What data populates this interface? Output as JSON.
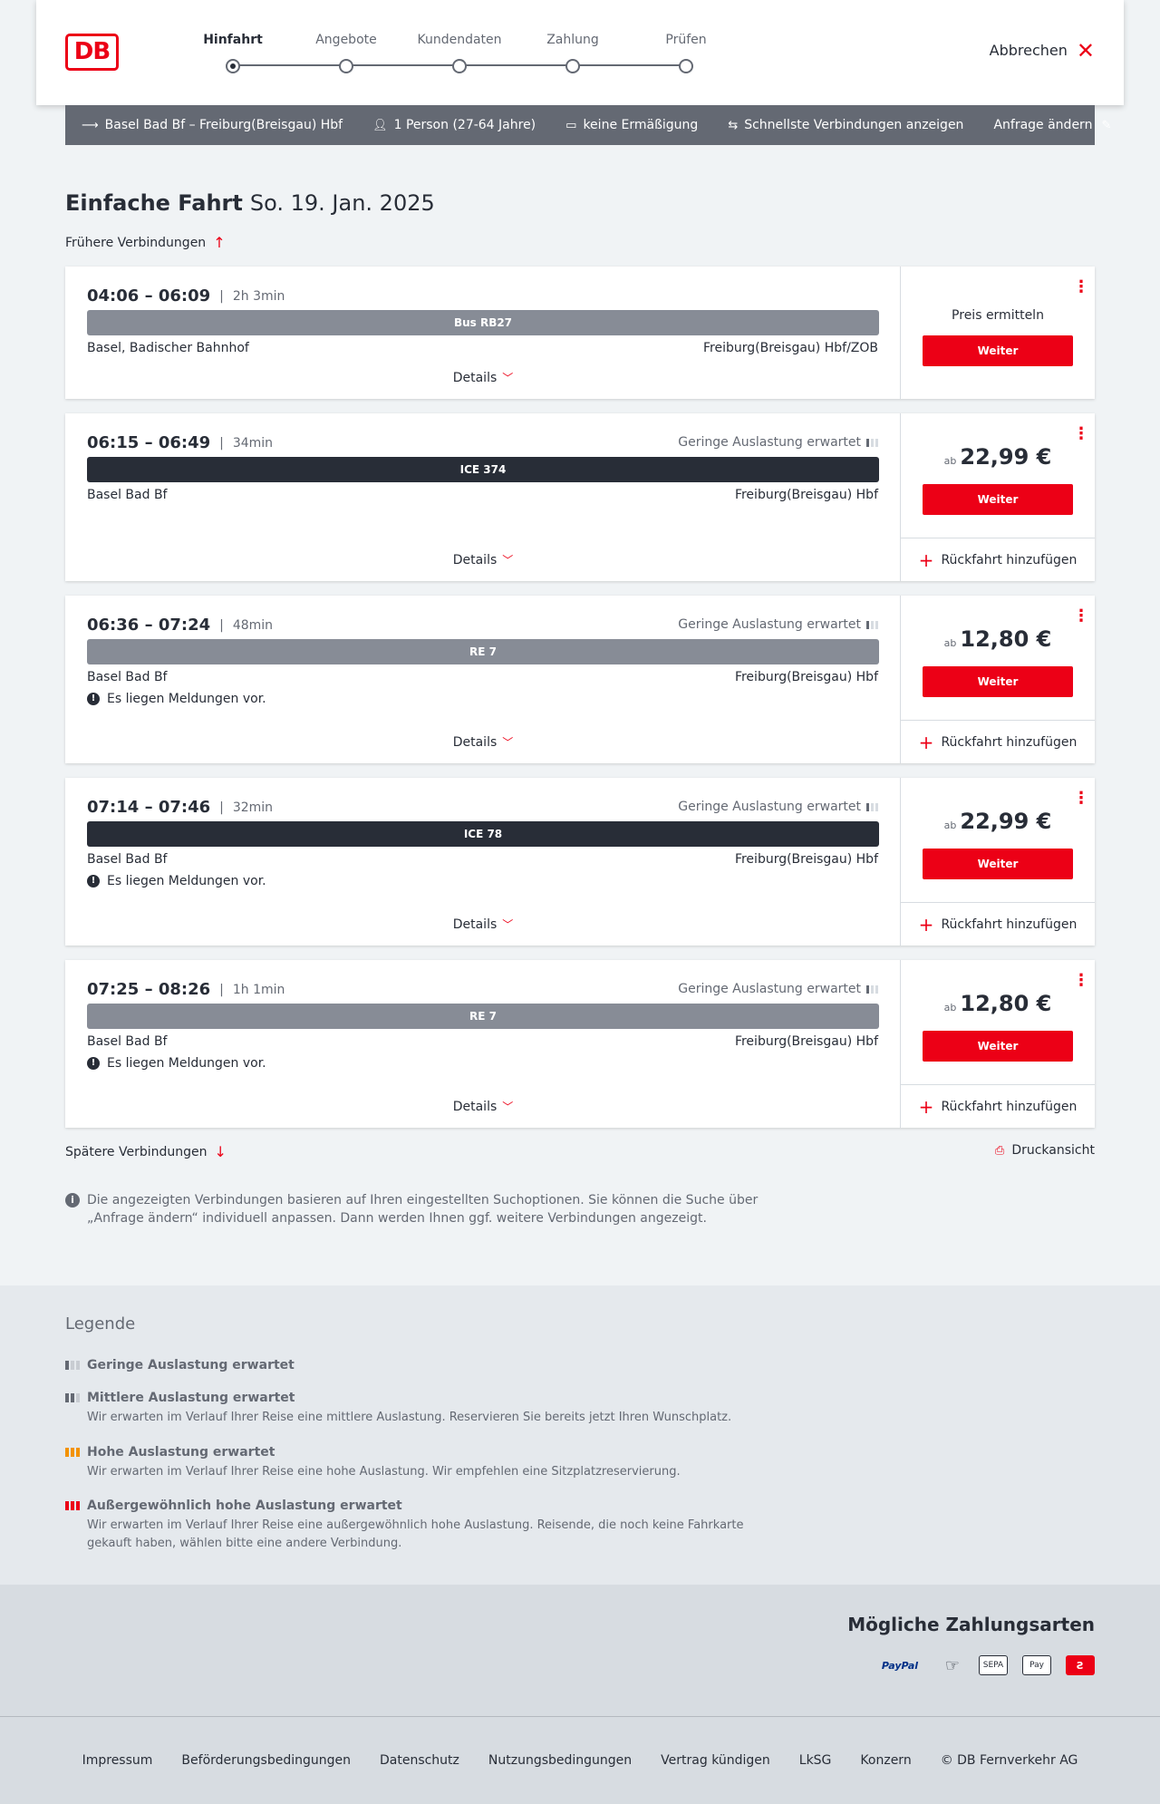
{
  "header": {
    "logo": "DB",
    "steps": [
      "Hinfahrt",
      "Angebote",
      "Kundendaten",
      "Zahlung",
      "Prüfen"
    ],
    "active_step": "Hinfahrt",
    "cancel_label": "Abbrechen"
  },
  "search": {
    "route": "Basel Bad Bf – Freiburg(Breisgau) Hbf",
    "passengers": "1 Person (27-64 Jahre)",
    "discount": "keine Ermäßigung",
    "filter": "Schnellste Verbindungen anzeigen",
    "change_label": "Anfrage ändern"
  },
  "page": {
    "title": "Einfache Fahrt",
    "date": "So. 19. Jan. 2025",
    "earlier": "Frühere Verbindungen",
    "later": "Spätere Verbindungen",
    "print": "Druckansicht",
    "info": "Die angezeigten Verbindungen basieren auf Ihren eingestellten Suchoptionen. Sie können die Suche über „Anfrage ändern“ individuell anpassen. Dann werden Ihnen ggf. weitere Verbindungen angezeigt."
  },
  "connections": [
    {
      "times": "04:06 – 06:09",
      "duration": "2h 3min",
      "occupancy": "",
      "train": "Bus RB27",
      "train_style": "grey",
      "from": "Basel, Badischer Bahnhof",
      "to": "Freiburg(Breisgau) Hbf/ZOB",
      "message": "",
      "price_prefix": "",
      "price": "",
      "price_text": "Preis ermitteln",
      "button": "Weiter",
      "details": "Details",
      "return": ""
    },
    {
      "times": "06:15 – 06:49",
      "duration": "34min",
      "occupancy": "Geringe Auslastung erwartet",
      "train": "ICE 374",
      "train_style": "dark",
      "from": "Basel Bad Bf",
      "to": "Freiburg(Breisgau) Hbf",
      "message": "",
      "price_prefix": "ab",
      "price": "22,99 €",
      "price_text": "",
      "button": "Weiter",
      "details": "Details",
      "return": "Rückfahrt hinzufügen"
    },
    {
      "times": "06:36 – 07:24",
      "duration": "48min",
      "occupancy": "Geringe Auslastung erwartet",
      "train": "RE 7",
      "train_style": "grey",
      "from": "Basel Bad Bf",
      "to": "Freiburg(Breisgau) Hbf",
      "message": "Es liegen Meldungen vor.",
      "price_prefix": "ab",
      "price": "12,80 €",
      "price_text": "",
      "button": "Weiter",
      "details": "Details",
      "return": "Rückfahrt hinzufügen"
    },
    {
      "times": "07:14 – 07:46",
      "duration": "32min",
      "occupancy": "Geringe Auslastung erwartet",
      "train": "ICE 78",
      "train_style": "dark",
      "from": "Basel Bad Bf",
      "to": "Freiburg(Breisgau) Hbf",
      "message": "Es liegen Meldungen vor.",
      "price_prefix": "ab",
      "price": "22,99 €",
      "price_text": "",
      "button": "Weiter",
      "details": "Details",
      "return": "Rückfahrt hinzufügen"
    },
    {
      "times": "07:25 – 08:26",
      "duration": "1h 1min",
      "occupancy": "Geringe Auslastung erwartet",
      "train": "RE 7",
      "train_style": "grey",
      "from": "Basel Bad Bf",
      "to": "Freiburg(Breisgau) Hbf",
      "message": "Es liegen Meldungen vor.",
      "price_prefix": "ab",
      "price": "12,80 €",
      "price_text": "",
      "button": "Weiter",
      "details": "Details",
      "return": "Rückfahrt hinzufügen"
    }
  ],
  "legend": {
    "title": "Legende",
    "items": [
      {
        "title": "Geringe Auslastung erwartet",
        "desc": ""
      },
      {
        "title": "Mittlere Auslastung erwartet",
        "desc": "Wir erwarten im Verlauf Ihrer Reise eine mittlere Auslastung. Reservieren Sie bereits jetzt Ihren Wunschplatz."
      },
      {
        "title": "Hohe Auslastung erwartet",
        "desc": "Wir erwarten im Verlauf Ihrer Reise eine hohe Auslastung. Wir empfehlen eine Sitzplatzreservierung."
      },
      {
        "title": "Außergewöhnlich hohe Auslastung erwartet",
        "desc": "Wir erwarten im Verlauf Ihrer Reise eine außergewöhnlich hohe Auslastung. Reisende, die noch keine Fahrkarte gekauft haben, wählen bitte eine andere Verbindung."
      }
    ]
  },
  "payments": {
    "title": "Mögliche Zahlungsarten",
    "paypal": "PayPal",
    "sepa": "SEPA",
    "applepay": "Pay"
  },
  "footer": [
    "Impressum",
    "Beförderungsbedingungen",
    "Datenschutz",
    "Nutzungsbedingungen",
    "Vertrag kündigen",
    "LkSG",
    "Konzern",
    "© DB Fernverkehr AG"
  ],
  "colors": {
    "brand": "#ec0016",
    "dark": "#282d37",
    "grey": "#646973"
  }
}
